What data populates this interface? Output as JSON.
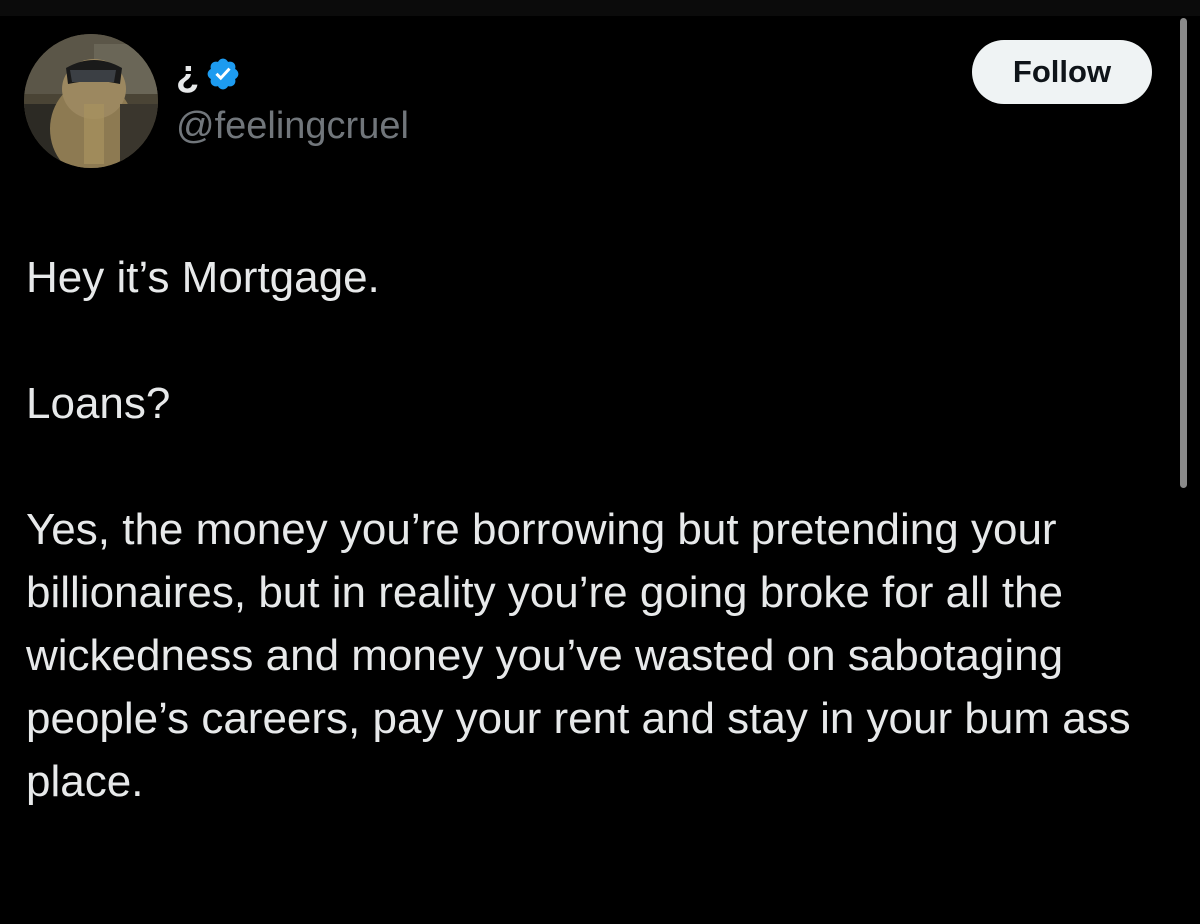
{
  "tweet": {
    "display_name": "¿",
    "handle": "@feelingcruel",
    "follow_label": "Follow",
    "paragraphs": [
      "Hey it’s Mortgage.",
      "Loans?",
      "Yes, the money you’re borrowing but pretending your billionaires, but in reality you’re going broke for all the wickedness and money you’ve wasted on sabotaging people’s careers, pay your rent and stay in your bum ass place."
    ]
  },
  "colors": {
    "background": "#000000",
    "text_primary": "#e7e9ea",
    "text_secondary": "#71767b",
    "verified_badge": "#1d9bf0",
    "follow_button_bg": "#eff3f4",
    "follow_button_text": "#0f1419"
  },
  "icons": {
    "verified": "verified-badge-icon",
    "avatar": "profile-avatar"
  }
}
